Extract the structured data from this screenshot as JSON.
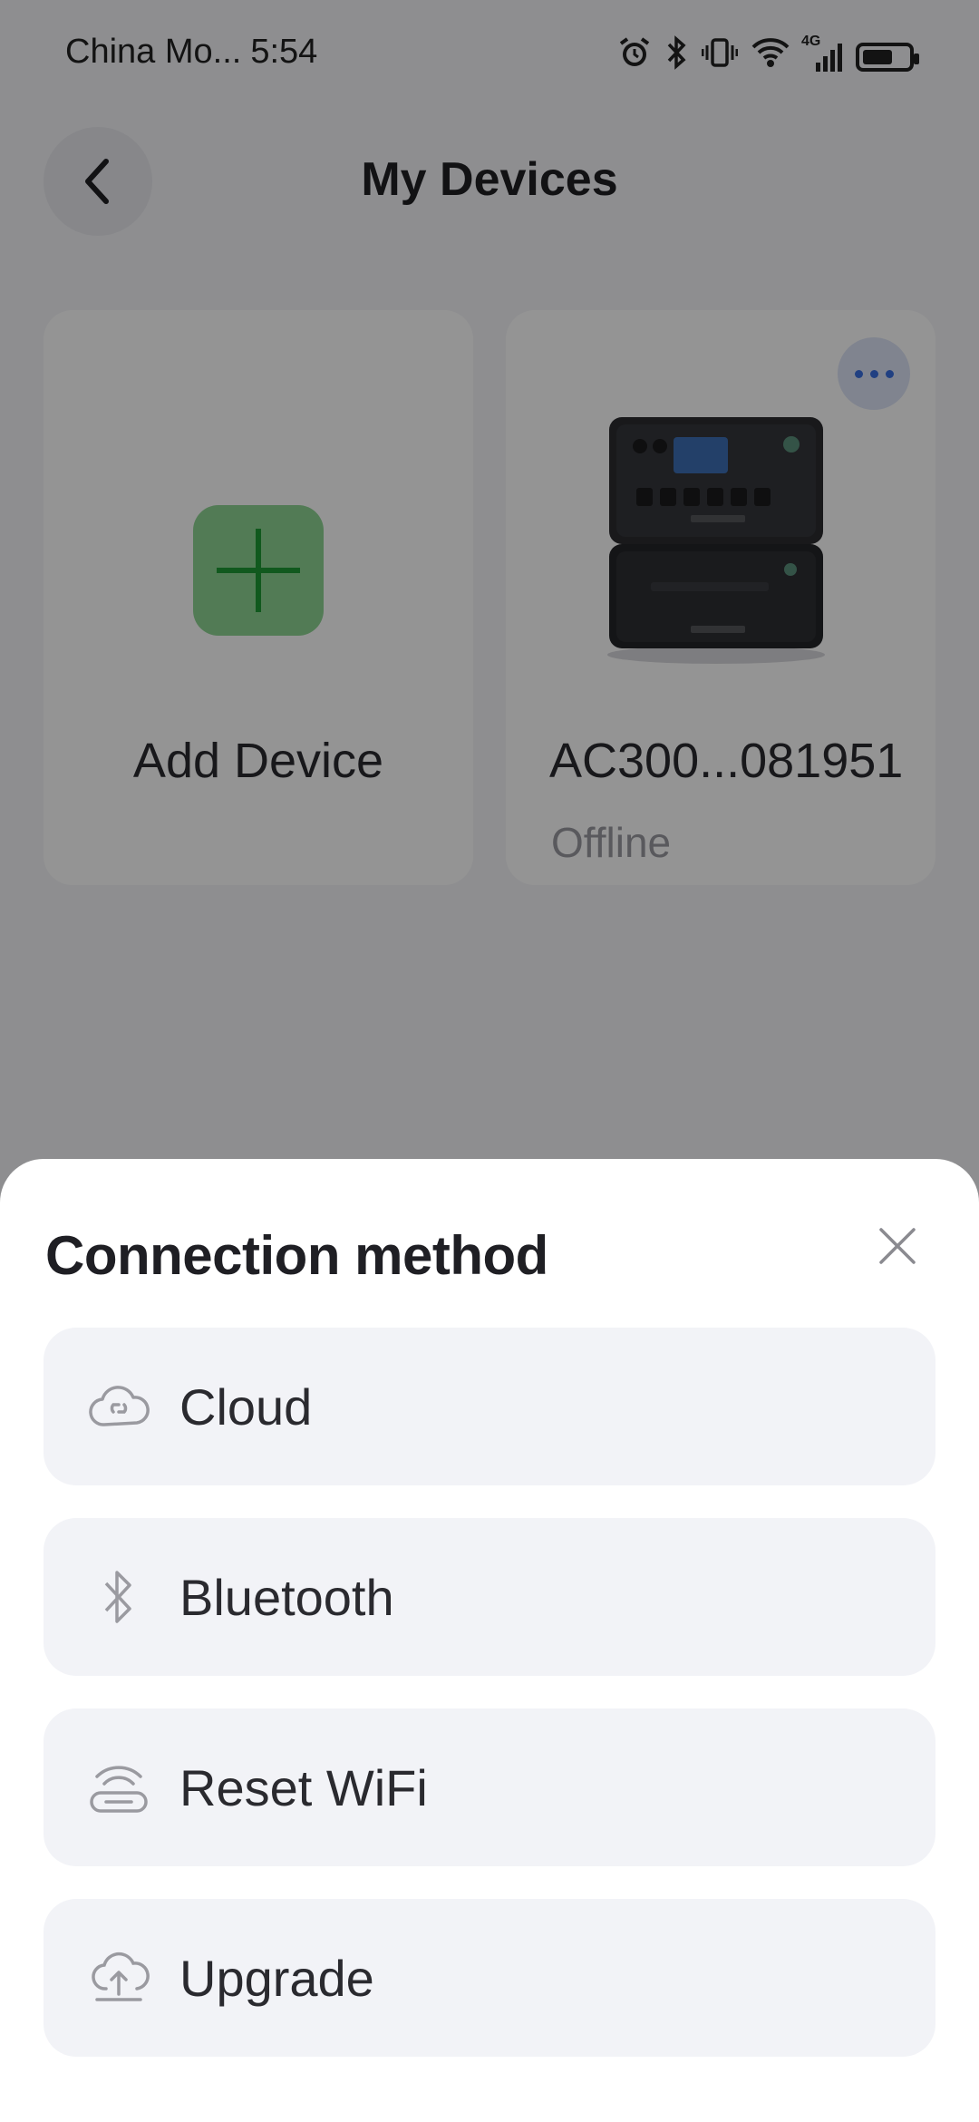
{
  "status_bar": {
    "carrier": "China Mo...",
    "time": "5:54",
    "network_label": "4G",
    "icons": [
      "alarm-icon",
      "bluetooth-icon",
      "vibrate-icon",
      "wifi-icon",
      "cellular-signal-icon",
      "battery-icon"
    ]
  },
  "header": {
    "title": "My Devices"
  },
  "devices": {
    "add_label": "Add Device",
    "items": [
      {
        "name": "AC300...081951",
        "status": "Offline"
      }
    ]
  },
  "sheet": {
    "title": "Connection method",
    "options": [
      {
        "label": "Cloud",
        "icon": "cloud-link-icon"
      },
      {
        "label": "Bluetooth",
        "icon": "bluetooth-icon"
      },
      {
        "label": "Reset WiFi",
        "icon": "wifi-router-icon"
      },
      {
        "label": "Upgrade",
        "icon": "cloud-upload-icon"
      }
    ]
  },
  "colors": {
    "accent_green": "#8ed493",
    "accent_blue": "#3a6fe0",
    "sheet_bg": "#ffffff",
    "option_bg": "#f2f3f7",
    "overlay": "rgba(0,0,0,0.42)"
  }
}
